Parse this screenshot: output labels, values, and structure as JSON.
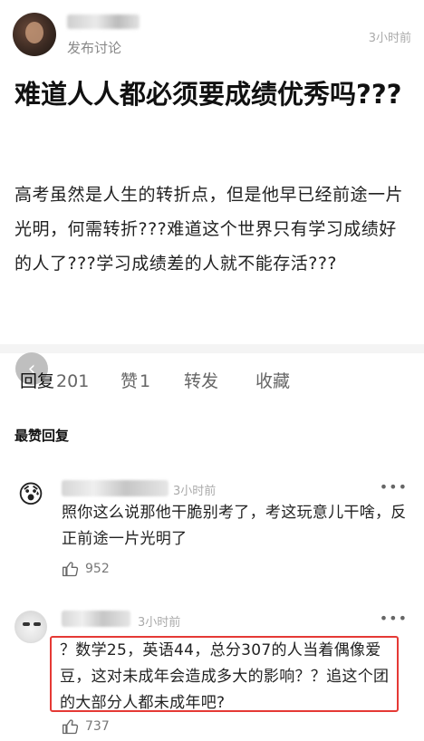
{
  "post": {
    "action": "发布讨论",
    "time": "3小时前",
    "title": "难道人人都必须要成绩优秀吗???",
    "body": "高考虽然是人生的转折点，但是他早已经前途一片光明，何需转折???难道这个世界只有学习成绩好的人了???学习成绩差的人就不能存活???"
  },
  "tabs": [
    {
      "label": "回复",
      "count": "201"
    },
    {
      "label": "赞",
      "count": "1"
    },
    {
      "label": "转发",
      "count": ""
    },
    {
      "label": "收藏",
      "count": ""
    }
  ],
  "section_label": "最赞回复",
  "comments": [
    {
      "avatar_icon": "😰",
      "time": "3小时前",
      "text": "照你这么说那他干脆别考了，考这玩意儿干啥，反正前途一片光明了",
      "likes": "952",
      "more": "•••"
    },
    {
      "time": "3小时前",
      "text": "？数学25，英语44，总分307的人当着偶像爱豆，这对未成年会造成多大的影响？？追这个团的大部分人都未成年吧?",
      "likes": "737",
      "more": "•••"
    }
  ],
  "colors": {
    "highlight": "#e53935"
  },
  "icons": {
    "back": "chevron-left-icon",
    "like": "thumbs-up-icon"
  }
}
